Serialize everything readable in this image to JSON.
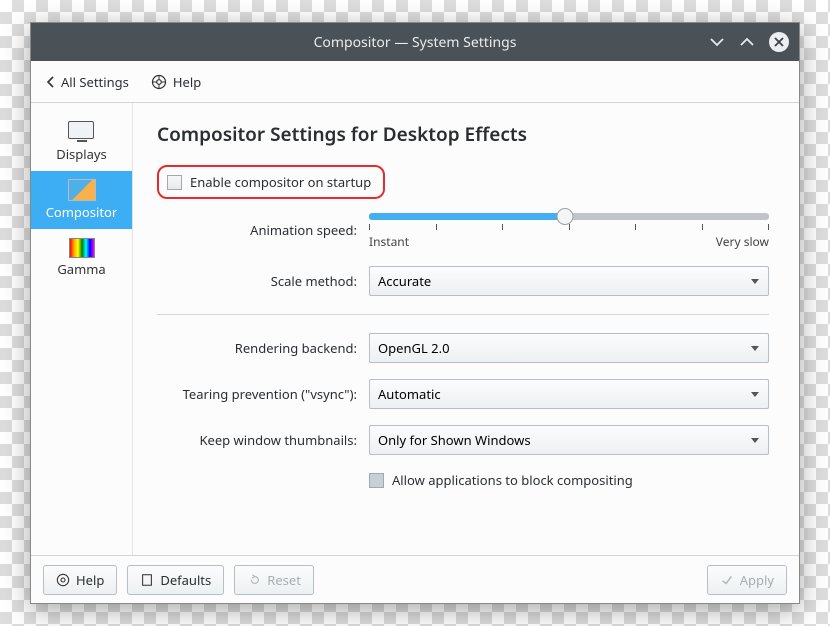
{
  "window": {
    "title": "Compositor — System Settings"
  },
  "toolbar": {
    "all_settings": "All Settings",
    "help": "Help"
  },
  "sidebar": {
    "items": [
      {
        "label": "Displays"
      },
      {
        "label": "Compositor"
      },
      {
        "label": "Gamma"
      }
    ]
  },
  "main": {
    "heading": "Compositor Settings for Desktop Effects",
    "enable_label": "Enable compositor on startup",
    "animation_label": "Animation speed:",
    "animation_min": "Instant",
    "animation_max": "Very slow",
    "scale_label": "Scale method:",
    "scale_value": "Accurate",
    "backend_label": "Rendering backend:",
    "backend_value": "OpenGL 2.0",
    "vsync_label": "Tearing prevention (\"vsync\"):",
    "vsync_value": "Automatic",
    "thumb_label": "Keep window thumbnails:",
    "thumb_value": "Only for Shown Windows",
    "block_label": "Allow applications to block compositing"
  },
  "footer": {
    "help": "Help",
    "defaults": "Defaults",
    "reset": "Reset",
    "apply": "Apply"
  }
}
